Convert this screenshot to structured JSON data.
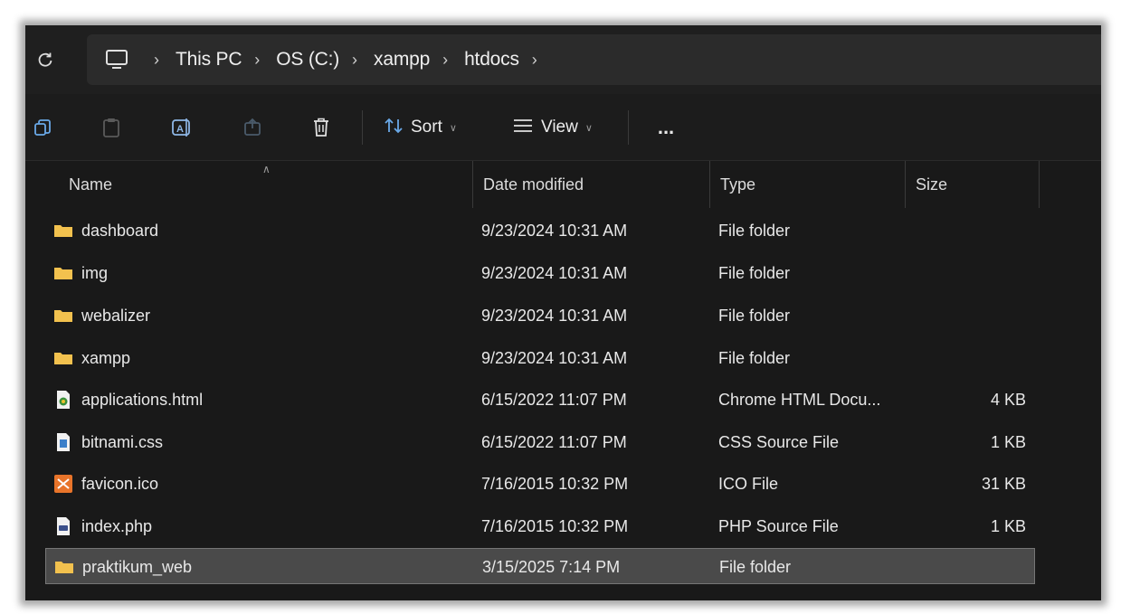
{
  "address": {
    "crumbs": [
      "This PC",
      "OS (C:)",
      "xampp",
      "htdocs"
    ]
  },
  "toolbar": {
    "sort_label": "Sort",
    "view_label": "View",
    "more_label": "..."
  },
  "columns": {
    "name": "Name",
    "date": "Date modified",
    "type": "Type",
    "size": "Size"
  },
  "files": [
    {
      "name": "dashboard",
      "date": "9/23/2024 10:31 AM",
      "type": "File folder",
      "size": "",
      "icon": "folder-icon"
    },
    {
      "name": "img",
      "date": "9/23/2024 10:31 AM",
      "type": "File folder",
      "size": "",
      "icon": "folder-icon"
    },
    {
      "name": "webalizer",
      "date": "9/23/2024 10:31 AM",
      "type": "File folder",
      "size": "",
      "icon": "folder-icon"
    },
    {
      "name": "xampp",
      "date": "9/23/2024 10:31 AM",
      "type": "File folder",
      "size": "",
      "icon": "folder-icon"
    },
    {
      "name": "applications.html",
      "date": "6/15/2022 11:07 PM",
      "type": "Chrome HTML Docu...",
      "size": "4 KB",
      "icon": "html-file-icon"
    },
    {
      "name": "bitnami.css",
      "date": "6/15/2022 11:07 PM",
      "type": "CSS Source File",
      "size": "1 KB",
      "icon": "css-file-icon"
    },
    {
      "name": "favicon.ico",
      "date": "7/16/2015 10:32 PM",
      "type": "ICO File",
      "size": "31 KB",
      "icon": "ico-file-icon"
    },
    {
      "name": "index.php",
      "date": "7/16/2015 10:32 PM",
      "type": "PHP Source File",
      "size": "1 KB",
      "icon": "php-file-icon"
    },
    {
      "name": "praktikum_web",
      "date": "3/15/2025 7:14 PM",
      "type": "File folder",
      "size": "",
      "icon": "folder-icon",
      "selected": true
    }
  ],
  "colors": {
    "folder": "#f2c14e",
    "selected_row": "#4a4a4a",
    "background": "#191919"
  }
}
